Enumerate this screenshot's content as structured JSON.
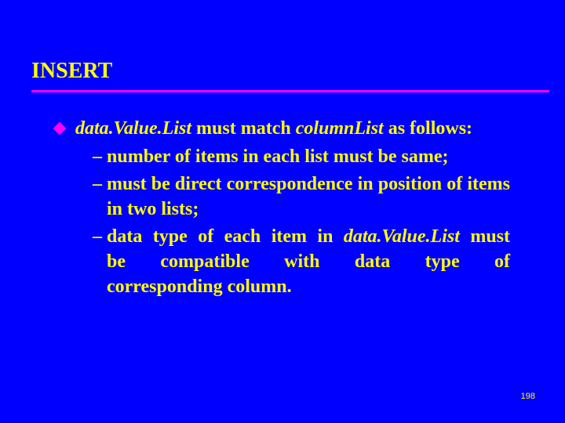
{
  "slide": {
    "title": "INSERT",
    "lead": {
      "part1_italic": "data.Value.List",
      "part2": " must match ",
      "part3_italic": "columnList",
      "part4": " as follows:"
    },
    "subitems": [
      {
        "text": "number of items in each list must be same;"
      },
      {
        "text": "must be direct correspondence in position of items in two lists;"
      },
      {
        "line1a": "data type of each item in ",
        "line1b_italic": "data.Value.List",
        "line1c": " must",
        "line2": "be compatible with data type of",
        "line3": "corresponding column."
      }
    ],
    "dash": "–",
    "page_number": "198"
  }
}
